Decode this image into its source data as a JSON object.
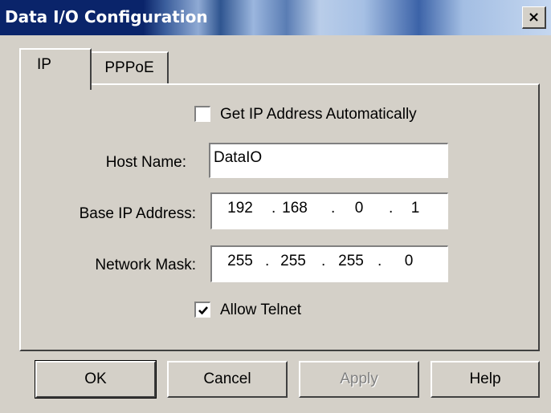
{
  "window": {
    "title": "Data I/O Configuration",
    "close_icon": "close-icon",
    "close_glyph": "×"
  },
  "tabs": [
    {
      "label": "IP",
      "selected": true
    },
    {
      "label": "PPPoE",
      "selected": false
    }
  ],
  "ip": {
    "auto_ip": {
      "label": "Get IP Address Automatically",
      "checked": false
    },
    "host_name": {
      "label": "Host Name:",
      "value": "DataIO"
    },
    "base_ip": {
      "label": "Base IP Address:",
      "octets": [
        "192",
        "168",
        "0",
        "1"
      ]
    },
    "network_mask": {
      "label": "Network Mask:",
      "octets": [
        "255",
        "255",
        "255",
        "0"
      ]
    },
    "allow_telnet": {
      "label": "Allow Telnet",
      "checked": true
    }
  },
  "buttons": {
    "ok": "OK",
    "cancel": "Cancel",
    "apply": "Apply",
    "help": "Help",
    "apply_enabled": false
  },
  "colors": {
    "face": "#d4d0c8",
    "title_active": "#0a246a",
    "disabled_text": "#808080"
  }
}
